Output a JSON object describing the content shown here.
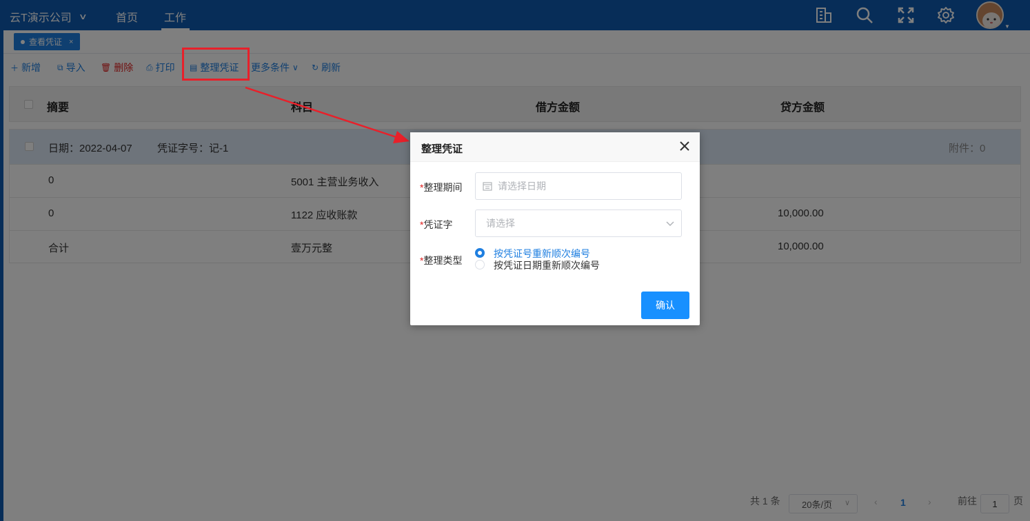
{
  "header": {
    "company": "云T演示公司",
    "nav": [
      "首页",
      "工作"
    ],
    "icons": [
      "building-icon",
      "search-icon",
      "fullscreen-icon",
      "gear-icon"
    ]
  },
  "tabs": [
    {
      "label": "查看凭证"
    }
  ],
  "toolbar": {
    "add": "新增",
    "import": "导入",
    "delete": "删除",
    "print": "打印",
    "organize": "整理凭证",
    "more": "更多条件",
    "refresh": "刷新"
  },
  "table": {
    "columns": [
      "摘要",
      "科目",
      "借方金额",
      "贷方金额"
    ],
    "voucher": {
      "date": "日期：2022-04-07",
      "number": "凭证字号：记-1",
      "attachments": "附件：0",
      "rows": [
        {
          "summary": "0",
          "account": "5001 主营业务收入",
          "debit": "",
          "credit": ""
        },
        {
          "summary": "0",
          "account": "1122 应收账款",
          "debit": "",
          "credit": "10,000.00"
        },
        {
          "summary": "合计",
          "account": "壹万元整",
          "debit": "",
          "credit": "10,000.00"
        }
      ]
    }
  },
  "pagination": {
    "total": "共 1 条",
    "page_size": "20条/页",
    "current": "1",
    "goto_label": "前往",
    "goto_value": "1",
    "page_suffix": "页"
  },
  "dialog": {
    "title": "整理凭证",
    "period_label": "整理期间",
    "period_placeholder": "请选择日期",
    "word_label": "凭证字",
    "word_placeholder": "请选择",
    "type_label": "整理类型",
    "type_options": [
      "按凭证号重新顺次编号",
      "按凭证日期重新顺次编号"
    ],
    "confirm": "确认",
    "required_mark": "*"
  },
  "colors": {
    "brand": "#0e5ab0",
    "accent": "#1f7fe0",
    "annotation": "#e8202a"
  }
}
